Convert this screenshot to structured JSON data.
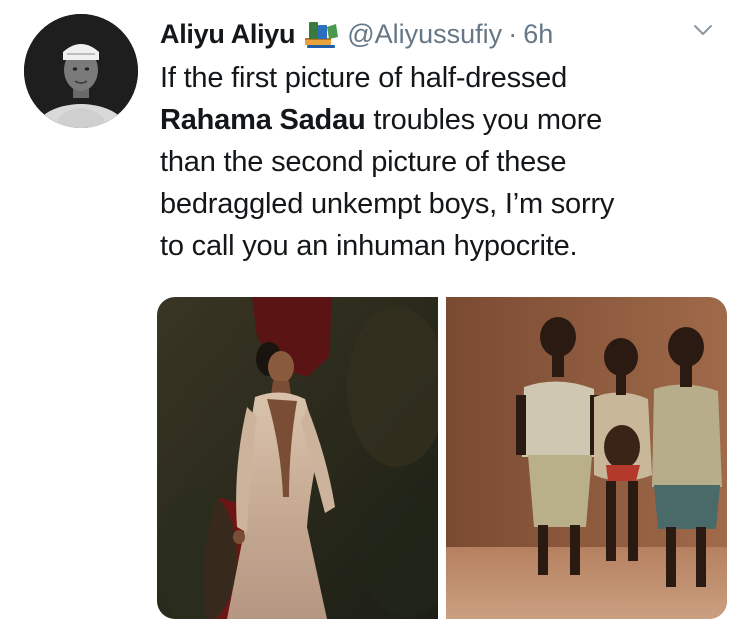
{
  "tweet": {
    "display_name": "Aliyu Aliyu",
    "name_emoji": "books-emoji",
    "handle": "@Aliyussufiy",
    "separator": "·",
    "time": "6h",
    "menu_icon": "chevron-down-icon",
    "text_lines": [
      {
        "text": "If the first picture of half-dressed"
      },
      {
        "bold": "Rahama Sadau",
        "text": " troubles you more"
      },
      {
        "text": "than the second picture of these"
      },
      {
        "text": "bedraggled unkempt boys, I’m sorry"
      },
      {
        "text": "to call you an inhuman hypocrite."
      }
    ],
    "media": [
      {
        "icon": "photo-woman-gown"
      },
      {
        "icon": "photo-three-boys"
      }
    ]
  },
  "colors": {
    "text": "#14171a",
    "secondary": "#657786",
    "background": "#ffffff"
  }
}
